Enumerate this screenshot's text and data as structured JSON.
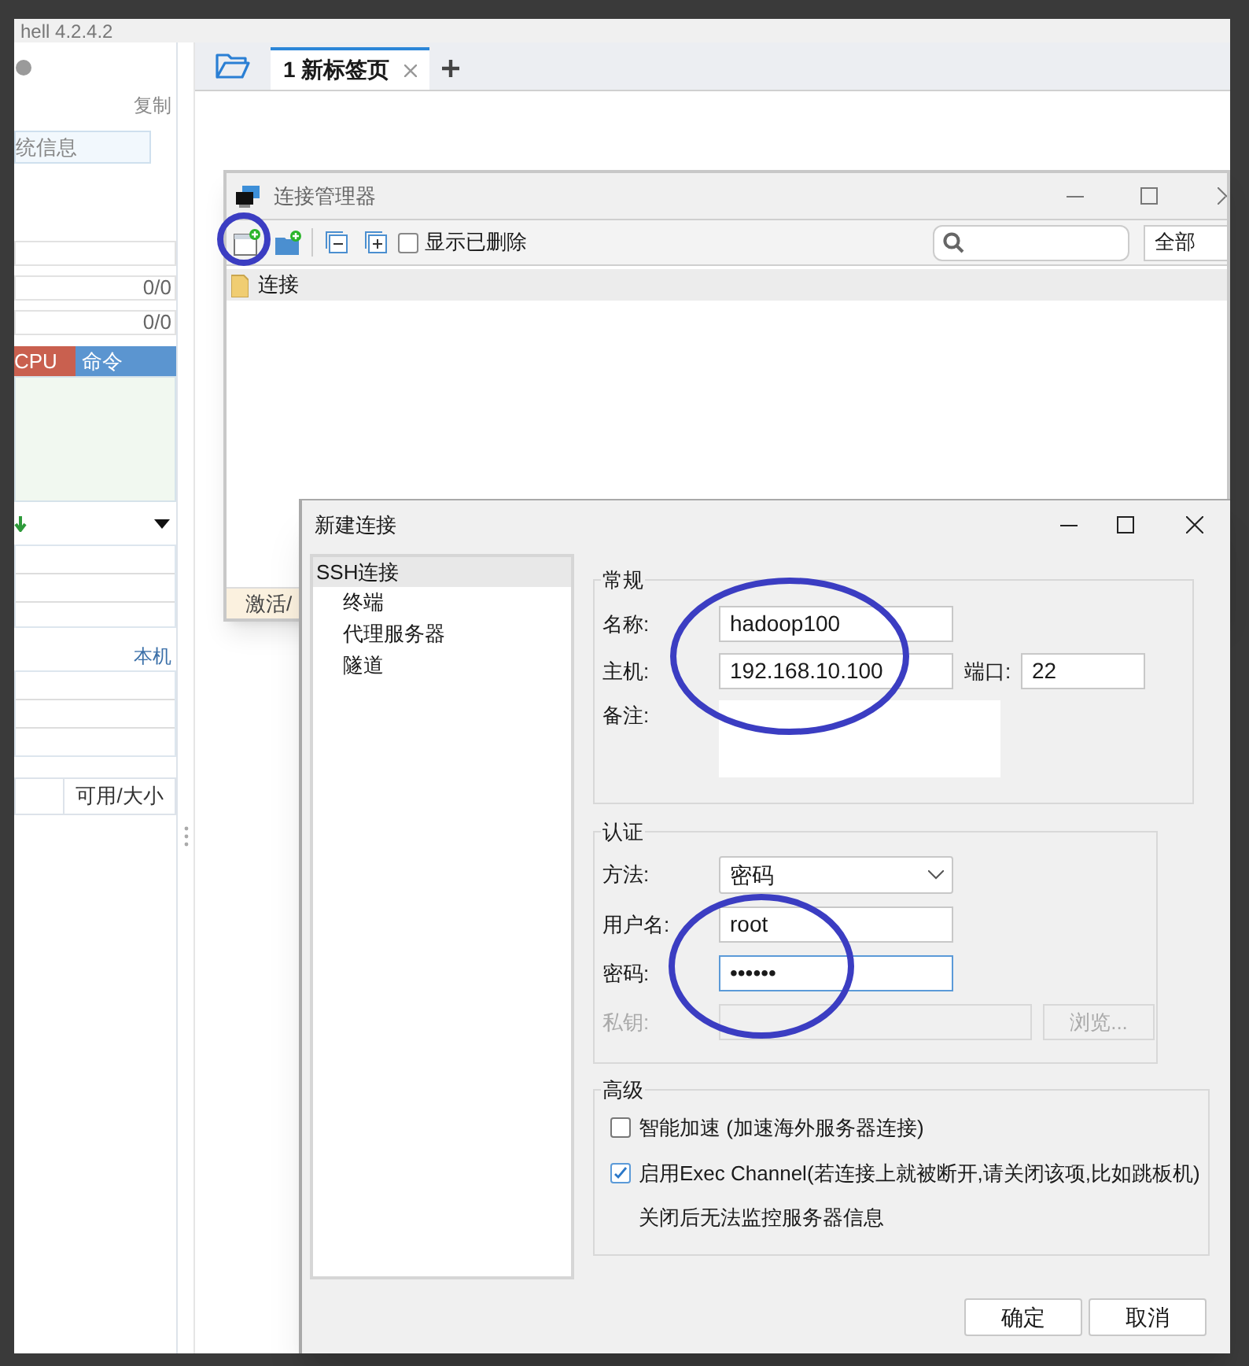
{
  "app_title": "hell 4.2.4.2",
  "sidebar": {
    "copy_link": "复制",
    "info_field": "统信息",
    "rows": [
      {
        "value": ""
      },
      {
        "value": "0/0"
      },
      {
        "value": "0/0"
      }
    ],
    "process_columns": [
      {
        "label": "CPU",
        "color": "#c9604f"
      },
      {
        "label": "命令",
        "color": "#5b95d0"
      }
    ],
    "local_link": "本机",
    "disk_column": "可用/大小"
  },
  "tabs": [
    {
      "label": "1 新标签页",
      "selected": true
    }
  ],
  "connection_manager": {
    "title": "连接管理器",
    "show_deleted": {
      "label": "显示已删除",
      "checked": false
    },
    "filter": "全部",
    "tree": [
      {
        "label": "连接"
      }
    ],
    "status": "激活/"
  },
  "dialog": {
    "title": "新建连接",
    "categories": [
      {
        "label": "SSH连接",
        "selected": true,
        "children": [
          {
            "label": "终端",
            "selected": false
          },
          {
            "label": "代理服务器",
            "selected": false
          },
          {
            "label": "隧道",
            "selected": false
          }
        ]
      }
    ],
    "general": {
      "title": "常规",
      "name": {
        "label": "名称:",
        "value": "hadoop100"
      },
      "host": {
        "label": "主机:",
        "value": "192.168.10.100"
      },
      "port": {
        "label": "端口:",
        "value": "22"
      },
      "note": {
        "label": "备注:"
      }
    },
    "auth": {
      "title": "认证",
      "method": {
        "label": "方法:",
        "value": "密码"
      },
      "username": {
        "label": "用户名:",
        "value": "root"
      },
      "password": {
        "label": "密码:",
        "value": "••••••",
        "focused": true
      },
      "private_key": {
        "label": "私钥:",
        "disabled": true
      },
      "browse": {
        "label": "浏览...",
        "disabled": true
      }
    },
    "advanced": {
      "title": "高级",
      "options": [
        {
          "label": "智能加速 (加速海外服务器连接)",
          "checked": false
        },
        {
          "label": "启用Exec Channel(若连接上就被断开,请关闭该项,比如跳板机)",
          "checked": true
        }
      ],
      "note": "关闭后无法监控服务器信息"
    },
    "buttons": [
      {
        "label": "确定"
      },
      {
        "label": "取消"
      }
    ]
  }
}
